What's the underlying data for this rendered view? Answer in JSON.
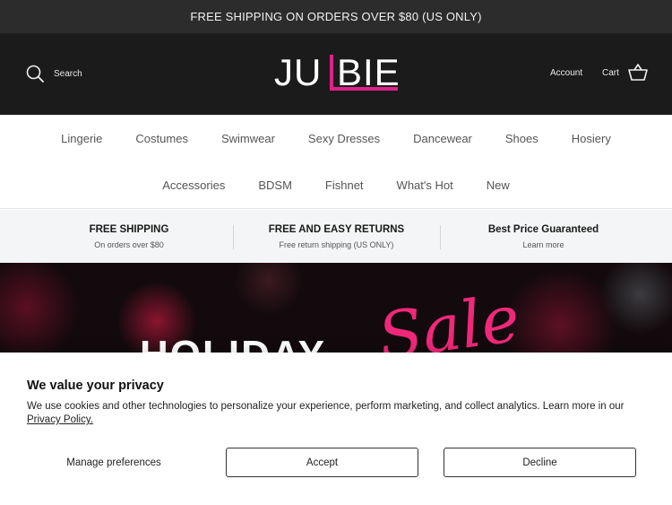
{
  "announcement": "FREE SHIPPING ON ORDERS OVER $80 (US ONLY)",
  "header": {
    "search_label": "Search",
    "logo_text": "JULBIE",
    "account_label": "Account",
    "cart_label": "Cart",
    "icons": [
      "search-icon",
      "cart-icon"
    ],
    "colors": {
      "background": "#1b1b1b",
      "brand_accent": "#e0208a"
    }
  },
  "nav": {
    "row1": [
      "Lingerie",
      "Costumes",
      "Swimwear",
      "Sexy Dresses",
      "Dancewear",
      "Shoes",
      "Hosiery"
    ],
    "row2": [
      "Accessories",
      "BDSM",
      "Fishnet",
      "What's Hot",
      "New"
    ]
  },
  "features": [
    {
      "title": "FREE SHIPPING",
      "subtitle": "On orders over $80"
    },
    {
      "title": "FREE AND EASY RETURNS",
      "subtitle": "Free return shipping (US ONLY)"
    },
    {
      "title": "Best Price Guaranteed",
      "subtitle": "Learn more"
    }
  ],
  "banner": {
    "word1": "HOLIDAY",
    "word2": "Sale"
  },
  "cookie": {
    "title": "We value your privacy",
    "body": "We use cookies and other technologies to personalize your experience, perform marketing, and collect analytics. Learn more in our ",
    "link": "Privacy Policy.",
    "manage_label": "Manage preferences",
    "accept_label": "Accept",
    "decline_label": "Decline"
  }
}
